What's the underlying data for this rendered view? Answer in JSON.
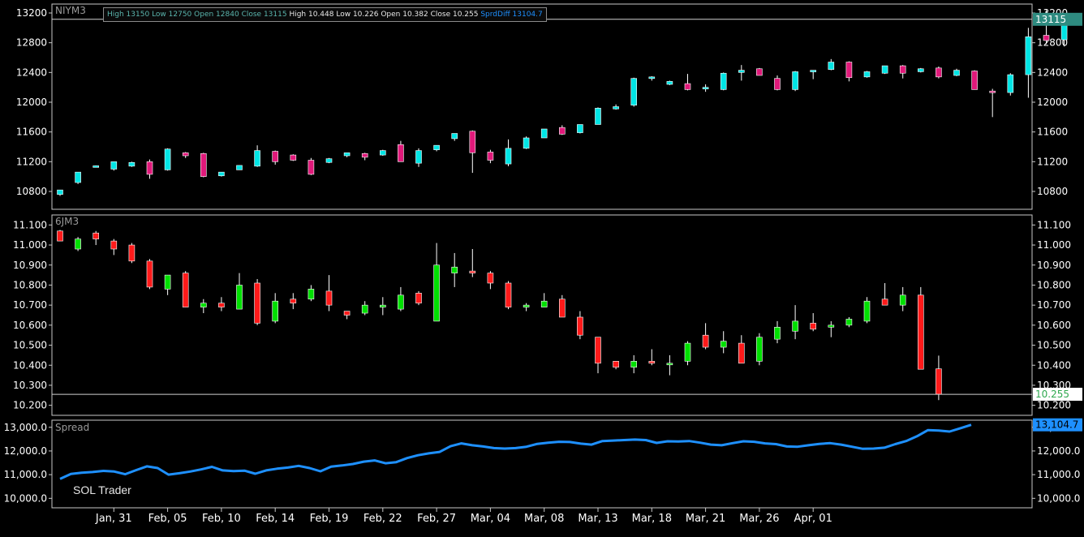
{
  "header": {
    "n1_high": "High 13150",
    "n1_low": "Low 12750",
    "n1_open": "Open 12840",
    "n1_close": "Close 13115",
    "n2_high": "High 10.448",
    "n2_low": "Low 10.226",
    "n2_open": "Open 10.382",
    "n2_close": "Close 10.255",
    "spread": "SprdDiff  13104.7"
  },
  "watermark": "SOL Trader",
  "colors": {
    "bg": "#000000",
    "axis": "#c8c8c8",
    "grid_label": "#ffffff",
    "p1_up": "#00e5e5",
    "p1_down": "#e0197a",
    "p2_up": "#00e000",
    "p2_down": "#ff1a1a",
    "spread": "#1e90ff",
    "label_gray": "#9a9a9a"
  },
  "x_labels": [
    "Jan, 31",
    "Feb, 05",
    "Feb, 10",
    "Feb, 14",
    "Feb, 19",
    "Feb, 22",
    "Feb, 27",
    "Mar, 04",
    "Mar, 08",
    "Mar, 13",
    "Mar, 18",
    "Mar, 21",
    "Mar, 26",
    "Apr, 01"
  ],
  "x_label_bar_index": [
    3,
    6,
    9,
    12,
    15,
    18,
    21,
    24,
    27,
    30,
    33,
    36,
    39,
    42
  ],
  "chart_data": [
    {
      "type": "candlestick",
      "title": "NIYM3",
      "ylim": [
        10560,
        13320
      ],
      "y_ticks": [
        10800,
        11200,
        11600,
        12000,
        12400,
        12800,
        13200
      ],
      "last_value_label": "13115",
      "candles": [
        {
          "o": 10760,
          "h": 10820,
          "l": 10740,
          "c": 10820
        },
        {
          "o": 10920,
          "h": 11060,
          "l": 10900,
          "c": 11060
        },
        {
          "o": 11140,
          "h": 11150,
          "l": 11130,
          "c": 11145
        },
        {
          "o": 11100,
          "h": 11200,
          "l": 11080,
          "c": 11200
        },
        {
          "o": 11140,
          "h": 11200,
          "l": 11130,
          "c": 11190
        },
        {
          "o": 11200,
          "h": 11230,
          "l": 10970,
          "c": 11030
        },
        {
          "o": 11090,
          "h": 11380,
          "l": 11080,
          "c": 11370
        },
        {
          "o": 11320,
          "h": 11330,
          "l": 11250,
          "c": 11280
        },
        {
          "o": 11310,
          "h": 11320,
          "l": 10990,
          "c": 11000
        },
        {
          "o": 11010,
          "h": 11060,
          "l": 11000,
          "c": 11060
        },
        {
          "o": 11090,
          "h": 11150,
          "l": 11090,
          "c": 11150
        },
        {
          "o": 11140,
          "h": 11420,
          "l": 11130,
          "c": 11350
        },
        {
          "o": 11340,
          "h": 11350,
          "l": 11160,
          "c": 11200
        },
        {
          "o": 11290,
          "h": 11300,
          "l": 11210,
          "c": 11220
        },
        {
          "o": 11220,
          "h": 11250,
          "l": 11020,
          "c": 11030
        },
        {
          "o": 11190,
          "h": 11250,
          "l": 11180,
          "c": 11240
        },
        {
          "o": 11280,
          "h": 11320,
          "l": 11260,
          "c": 11320
        },
        {
          "o": 11310,
          "h": 11320,
          "l": 11220,
          "c": 11260
        },
        {
          "o": 11290,
          "h": 11360,
          "l": 11280,
          "c": 11350
        },
        {
          "o": 11430,
          "h": 11480,
          "l": 11200,
          "c": 11200
        },
        {
          "o": 11180,
          "h": 11380,
          "l": 11130,
          "c": 11350
        },
        {
          "o": 11360,
          "h": 11420,
          "l": 11340,
          "c": 11420
        },
        {
          "o": 11510,
          "h": 11580,
          "l": 11480,
          "c": 11580
        },
        {
          "o": 11610,
          "h": 11620,
          "l": 11050,
          "c": 11320
        },
        {
          "o": 11330,
          "h": 11360,
          "l": 11180,
          "c": 11220
        },
        {
          "o": 11170,
          "h": 11500,
          "l": 11140,
          "c": 11380
        },
        {
          "o": 11380,
          "h": 11540,
          "l": 11370,
          "c": 11520
        },
        {
          "o": 11520,
          "h": 11640,
          "l": 11520,
          "c": 11640
        },
        {
          "o": 11660,
          "h": 11690,
          "l": 11560,
          "c": 11570
        },
        {
          "o": 11590,
          "h": 11700,
          "l": 11580,
          "c": 11700
        },
        {
          "o": 11700,
          "h": 11930,
          "l": 11700,
          "c": 11920
        },
        {
          "o": 11910,
          "h": 11970,
          "l": 11900,
          "c": 11940
        },
        {
          "o": 11960,
          "h": 12330,
          "l": 11940,
          "c": 12320
        },
        {
          "o": 12320,
          "h": 12350,
          "l": 12290,
          "c": 12340
        },
        {
          "o": 12240,
          "h": 12290,
          "l": 12230,
          "c": 12280
        },
        {
          "o": 12250,
          "h": 12380,
          "l": 12160,
          "c": 12170
        },
        {
          "o": 12180,
          "h": 12240,
          "l": 12140,
          "c": 12200
        },
        {
          "o": 12170,
          "h": 12400,
          "l": 12160,
          "c": 12390
        },
        {
          "o": 12400,
          "h": 12500,
          "l": 12290,
          "c": 12430
        },
        {
          "o": 12450,
          "h": 12460,
          "l": 12360,
          "c": 12360
        },
        {
          "o": 12320,
          "h": 12360,
          "l": 12160,
          "c": 12170
        },
        {
          "o": 12170,
          "h": 12420,
          "l": 12150,
          "c": 12410
        },
        {
          "o": 12410,
          "h": 12430,
          "l": 12310,
          "c": 12430
        },
        {
          "o": 12440,
          "h": 12580,
          "l": 12430,
          "c": 12540
        },
        {
          "o": 12540,
          "h": 12550,
          "l": 12280,
          "c": 12330
        },
        {
          "o": 12340,
          "h": 12420,
          "l": 12330,
          "c": 12410
        },
        {
          "o": 12390,
          "h": 12490,
          "l": 12380,
          "c": 12490
        },
        {
          "o": 12490,
          "h": 12500,
          "l": 12320,
          "c": 12390
        },
        {
          "o": 12410,
          "h": 12460,
          "l": 12400,
          "c": 12450
        },
        {
          "o": 12460,
          "h": 12480,
          "l": 12320,
          "c": 12340
        },
        {
          "o": 12360,
          "h": 12450,
          "l": 12350,
          "c": 12430
        },
        {
          "o": 12420,
          "h": 12430,
          "l": 12170,
          "c": 12170
        },
        {
          "o": 12150,
          "h": 12180,
          "l": 11800,
          "c": 12140
        },
        {
          "o": 12130,
          "h": 12390,
          "l": 12090,
          "c": 12370
        },
        {
          "o": 12370,
          "h": 13000,
          "l": 12060,
          "c": 12880
        },
        {
          "o": 12900,
          "h": 13240,
          "l": 12780,
          "c": 12830
        },
        {
          "o": 12840,
          "h": 13150,
          "l": 12750,
          "c": 13115
        }
      ]
    },
    {
      "type": "candlestick",
      "title": "6JM3",
      "ylim": [
        10.15,
        11.15
      ],
      "y_ticks": [
        10.2,
        10.3,
        10.4,
        10.5,
        10.6,
        10.7,
        10.8,
        10.9,
        11.0,
        11.1
      ],
      "last_value_label": "10.255",
      "candles": [
        {
          "o": 11.07,
          "h": 11.075,
          "l": 11.02,
          "c": 11.02
        },
        {
          "o": 10.98,
          "h": 11.04,
          "l": 10.97,
          "c": 11.03
        },
        {
          "o": 11.06,
          "h": 11.07,
          "l": 11.0,
          "c": 11.03
        },
        {
          "o": 11.02,
          "h": 11.03,
          "l": 10.95,
          "c": 10.98
        },
        {
          "o": 11.0,
          "h": 11.01,
          "l": 10.91,
          "c": 10.92
        },
        {
          "o": 10.92,
          "h": 10.93,
          "l": 10.78,
          "c": 10.79
        },
        {
          "o": 10.78,
          "h": 10.85,
          "l": 10.75,
          "c": 10.85
        },
        {
          "o": 10.86,
          "h": 10.87,
          "l": 10.69,
          "c": 10.69
        },
        {
          "o": 10.69,
          "h": 10.73,
          "l": 10.66,
          "c": 10.71
        },
        {
          "o": 10.71,
          "h": 10.74,
          "l": 10.67,
          "c": 10.69
        },
        {
          "o": 10.68,
          "h": 10.86,
          "l": 10.68,
          "c": 10.8
        },
        {
          "o": 10.81,
          "h": 10.83,
          "l": 10.6,
          "c": 10.61
        },
        {
          "o": 10.62,
          "h": 10.76,
          "l": 10.61,
          "c": 10.72
        },
        {
          "o": 10.73,
          "h": 10.76,
          "l": 10.68,
          "c": 10.71
        },
        {
          "o": 10.73,
          "h": 10.8,
          "l": 10.72,
          "c": 10.78
        },
        {
          "o": 10.77,
          "h": 10.85,
          "l": 10.67,
          "c": 10.7
        },
        {
          "o": 10.67,
          "h": 10.67,
          "l": 10.63,
          "c": 10.65
        },
        {
          "o": 10.66,
          "h": 10.72,
          "l": 10.65,
          "c": 10.7
        },
        {
          "o": 10.69,
          "h": 10.74,
          "l": 10.65,
          "c": 10.7
        },
        {
          "o": 10.68,
          "h": 10.79,
          "l": 10.67,
          "c": 10.75
        },
        {
          "o": 10.76,
          "h": 10.77,
          "l": 10.7,
          "c": 10.71
        },
        {
          "o": 10.62,
          "h": 11.01,
          "l": 10.62,
          "c": 10.9
        },
        {
          "o": 10.86,
          "h": 10.96,
          "l": 10.79,
          "c": 10.89
        },
        {
          "o": 10.87,
          "h": 10.98,
          "l": 10.84,
          "c": 10.86
        },
        {
          "o": 10.86,
          "h": 10.87,
          "l": 10.78,
          "c": 10.81
        },
        {
          "o": 10.81,
          "h": 10.82,
          "l": 10.68,
          "c": 10.69
        },
        {
          "o": 10.69,
          "h": 10.71,
          "l": 10.67,
          "c": 10.7
        },
        {
          "o": 10.69,
          "h": 10.76,
          "l": 10.69,
          "c": 10.72
        },
        {
          "o": 10.73,
          "h": 10.75,
          "l": 10.64,
          "c": 10.64
        },
        {
          "o": 10.64,
          "h": 10.67,
          "l": 10.53,
          "c": 10.55
        },
        {
          "o": 10.54,
          "h": 10.54,
          "l": 10.36,
          "c": 10.41
        },
        {
          "o": 10.42,
          "h": 10.42,
          "l": 10.38,
          "c": 10.39
        },
        {
          "o": 10.39,
          "h": 10.45,
          "l": 10.36,
          "c": 10.42
        },
        {
          "o": 10.42,
          "h": 10.48,
          "l": 10.4,
          "c": 10.41
        },
        {
          "o": 10.41,
          "h": 10.45,
          "l": 10.35,
          "c": 10.41
        },
        {
          "o": 10.42,
          "h": 10.52,
          "l": 10.4,
          "c": 10.51
        },
        {
          "o": 10.55,
          "h": 10.61,
          "l": 10.48,
          "c": 10.49
        },
        {
          "o": 10.49,
          "h": 10.57,
          "l": 10.46,
          "c": 10.52
        },
        {
          "o": 10.51,
          "h": 10.55,
          "l": 10.41,
          "c": 10.41
        },
        {
          "o": 10.42,
          "h": 10.56,
          "l": 10.4,
          "c": 10.54
        },
        {
          "o": 10.53,
          "h": 10.62,
          "l": 10.51,
          "c": 10.59
        },
        {
          "o": 10.57,
          "h": 10.7,
          "l": 10.53,
          "c": 10.62
        },
        {
          "o": 10.61,
          "h": 10.66,
          "l": 10.57,
          "c": 10.58
        },
        {
          "o": 10.59,
          "h": 10.62,
          "l": 10.54,
          "c": 10.6
        },
        {
          "o": 10.6,
          "h": 10.64,
          "l": 10.59,
          "c": 10.63
        },
        {
          "o": 10.62,
          "h": 10.74,
          "l": 10.61,
          "c": 10.72
        },
        {
          "o": 10.73,
          "h": 10.81,
          "l": 10.7,
          "c": 10.7
        },
        {
          "o": 10.7,
          "h": 10.79,
          "l": 10.67,
          "c": 10.75
        },
        {
          "o": 10.75,
          "h": 10.79,
          "l": 10.38,
          "c": 10.38
        },
        {
          "o": 10.382,
          "h": 10.448,
          "l": 10.226,
          "c": 10.255
        }
      ]
    },
    {
      "type": "line",
      "title": "Spread",
      "ylim": [
        9600,
        13300
      ],
      "y_ticks": [
        10000,
        11000,
        12000,
        13000
      ],
      "y_tick_labels": [
        "10,000.0",
        "11,000.0",
        "12,000.0",
        "13,000.0"
      ],
      "last_value_label": "13,104.7",
      "values": [
        10820,
        11030,
        11080,
        11110,
        11160,
        11130,
        11020,
        11190,
        11350,
        11280,
        11000,
        11060,
        11130,
        11220,
        11330,
        11180,
        11150,
        11170,
        11040,
        11180,
        11250,
        11300,
        11370,
        11280,
        11140,
        11340,
        11390,
        11450,
        11550,
        11600,
        11480,
        11530,
        11700,
        11820,
        11900,
        11960,
        12200,
        12320,
        12240,
        12190,
        12120,
        12100,
        12120,
        12180,
        12300,
        12350,
        12390,
        12380,
        12310,
        12270,
        12420,
        12440,
        12460,
        12480,
        12460,
        12340,
        12410,
        12400,
        12420,
        12350,
        12270,
        12240,
        12330,
        12410,
        12390,
        12320,
        12290,
        12190,
        12180,
        12240,
        12300,
        12330,
        12270,
        12180,
        12090,
        12100,
        12140,
        12290,
        12420,
        12620,
        12880,
        12860,
        12820,
        12960,
        13104.7
      ]
    }
  ]
}
